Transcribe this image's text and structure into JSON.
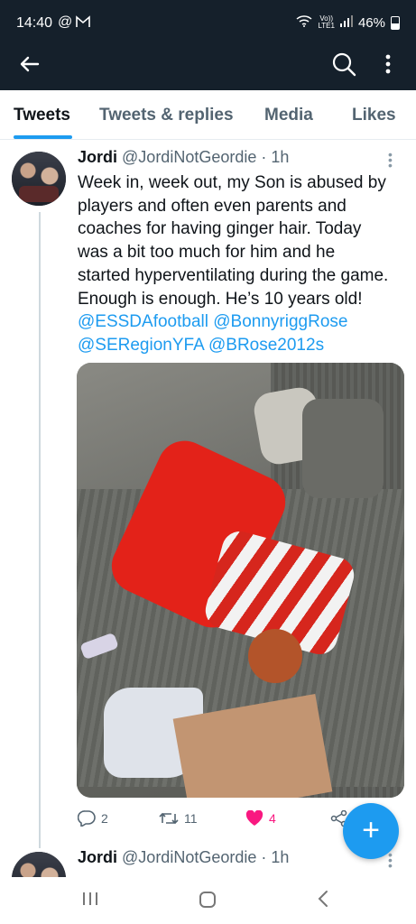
{
  "status_bar": {
    "time": "14:40",
    "at_symbol": "@",
    "mail_icon": "M",
    "network": "Vo))\nLTE1",
    "battery": "46%"
  },
  "tabs": [
    {
      "label": "Tweets",
      "active": true
    },
    {
      "label": "Tweets & replies",
      "active": false
    },
    {
      "label": "Media",
      "active": false
    },
    {
      "label": "Likes",
      "active": false
    }
  ],
  "tweet": {
    "display_name": "Jordi",
    "handle": "@JordiNotGeordie",
    "separator": "·",
    "time": "1h",
    "lines": [
      "Week in, week out, my Son is abused by",
      "players and often even parents and",
      "coaches for having ginger hair. Today",
      "was a bit too much for him and he",
      "started hyperventilating during the game.",
      "Enough is enough. He’s 10 years old!"
    ],
    "mentions": [
      [
        "@ESSDAfootball",
        "@BonnyriggRose"
      ],
      [
        "@SERegionYFA",
        "@BRose2012s"
      ]
    ],
    "replies": "2",
    "retweets": "11",
    "likes": "4"
  },
  "tweet2": {
    "display_name": "Jordi",
    "handle": "@JordiNotGeordie",
    "separator": "·",
    "time": "1h"
  },
  "fab": {
    "label": "+"
  },
  "colors": {
    "header_bg": "#15202b",
    "accent": "#1d9bf0",
    "like": "#f91880",
    "text": "#0f1419",
    "secondary": "#536471"
  },
  "icons": {
    "back": "arrow-left-icon",
    "search": "search-icon",
    "more": "more-vertical-icon",
    "reply": "reply-icon",
    "retweet": "retweet-icon",
    "like": "heart-icon",
    "share": "share-icon",
    "compose": "plus-icon"
  }
}
